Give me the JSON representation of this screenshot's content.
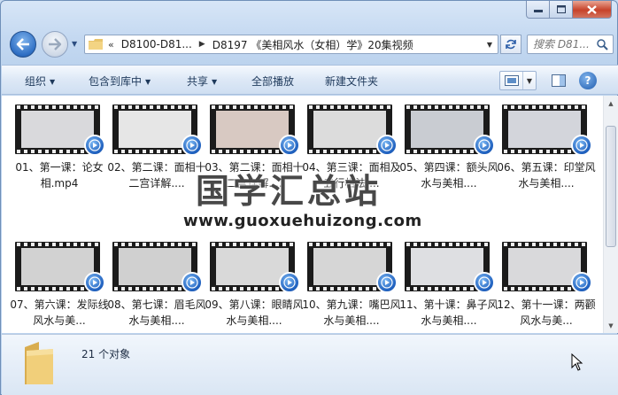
{
  "window": {
    "caption": {
      "minimize": "—",
      "maximize": "□",
      "close": "✕"
    }
  },
  "address": {
    "chevrons": "«",
    "crumbs": [
      "D8100-D81...",
      "D8197 《美相风水（女相）学》20集视频"
    ],
    "search_placeholder": "搜索 D81..."
  },
  "toolbar": {
    "organize": "组织",
    "include_library": "包含到库中",
    "share": "共享",
    "play_all": "全部播放",
    "new_folder": "新建文件夹"
  },
  "files": [
    {
      "name": "01、第一课：论女相.mp4",
      "frame": "#d9d9dc"
    },
    {
      "name": "02、第二课：面相十二宫详解....",
      "frame": "#e6e6e6"
    },
    {
      "name": "03、第二课：面相十二宫详解....",
      "frame": "#d8c9c2"
    },
    {
      "name": "04、第三课：面相及五行相法....",
      "frame": "#dcdcdc"
    },
    {
      "name": "05、第四课：额头风水与美相....",
      "frame": "#c9ccd2"
    },
    {
      "name": "06、第五课：印堂风水与美相....",
      "frame": "#d3d5db"
    },
    {
      "name": "07、第六课：发际线风水与美...",
      "frame": "#d2d2d2"
    },
    {
      "name": "08、第七课：眉毛风水与美相....",
      "frame": "#d0d0d0"
    },
    {
      "name": "09、第八课：眼睛风水与美相....",
      "frame": "#d9d9d9"
    },
    {
      "name": "10、第九课：嘴巴风水与美相....",
      "frame": "#d6d6d6"
    },
    {
      "name": "11、第十课：鼻子风水与美相....",
      "frame": "#dedfe2"
    },
    {
      "name": "12、第十一课：两颧风水与美...",
      "frame": "#d9d9db"
    }
  ],
  "watermark": {
    "title": "国学汇总站",
    "url": "www.guoxuehuizong.com"
  },
  "details": {
    "count": "21 个对象"
  }
}
